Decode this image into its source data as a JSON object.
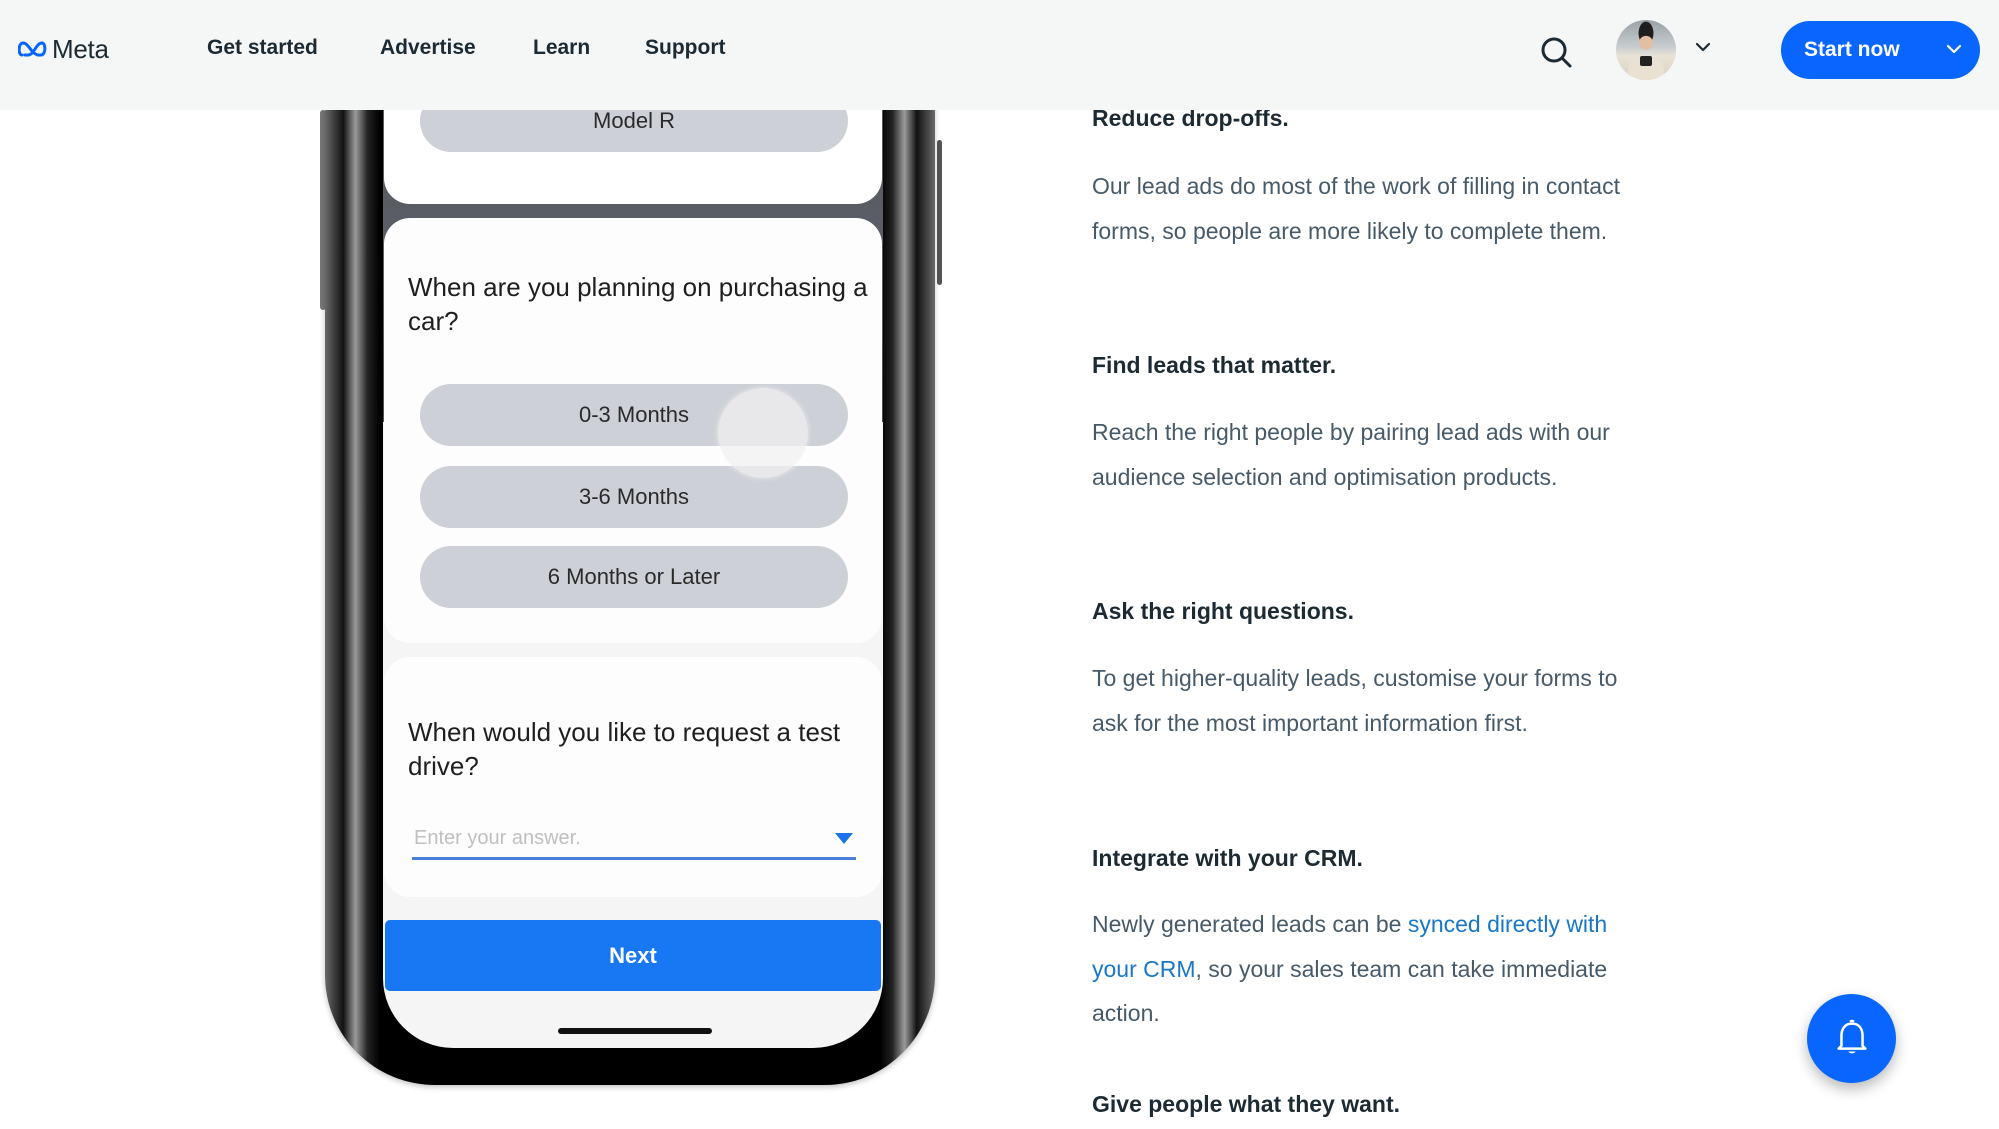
{
  "header": {
    "logo_text": "Meta",
    "nav": [
      {
        "label": "Get started"
      },
      {
        "label": "Advertise"
      },
      {
        "label": "Learn"
      },
      {
        "label": "Support"
      }
    ],
    "search_icon": "search-icon",
    "avatar_icon": "user-avatar",
    "avatar_menu_icon": "chevron-down-icon",
    "start_button": {
      "label": "Start now",
      "icon": "chevron-down-icon"
    },
    "accent_color": "#0866ff"
  },
  "phone": {
    "card1": {
      "option": "Model R"
    },
    "card2": {
      "question": "When are you planning on purchasing a car?",
      "options": [
        "0-3 Months",
        "3-6 Months",
        "6 Months or Later"
      ]
    },
    "card3": {
      "question": "When would you like to request a test drive?",
      "input_placeholder": "Enter your answer.",
      "dropdown_icon": "caret-down-icon"
    },
    "next_button": "Next"
  },
  "content": {
    "sections": [
      {
        "heading": "Reduce drop-offs.",
        "body": "Our lead ads do most of the work of filling in contact forms, so people are more likely to complete them."
      },
      {
        "heading": "Find leads that matter.",
        "body": "Reach the right people by pairing lead ads with our audience selection and optimisation products."
      },
      {
        "heading": "Ask the right questions.",
        "body": "To get higher-quality leads, customise your forms to ask for the most important information first."
      },
      {
        "heading": "Integrate with your CRM.",
        "body_before": "Newly generated leads can be ",
        "body_link": "synced directly with your CRM",
        "body_after": ", so your sales team can take immediate action."
      },
      {
        "heading": "Give people what they want."
      }
    ],
    "link_color": "#1877c6"
  },
  "notification_button": {
    "icon": "bell-icon"
  }
}
